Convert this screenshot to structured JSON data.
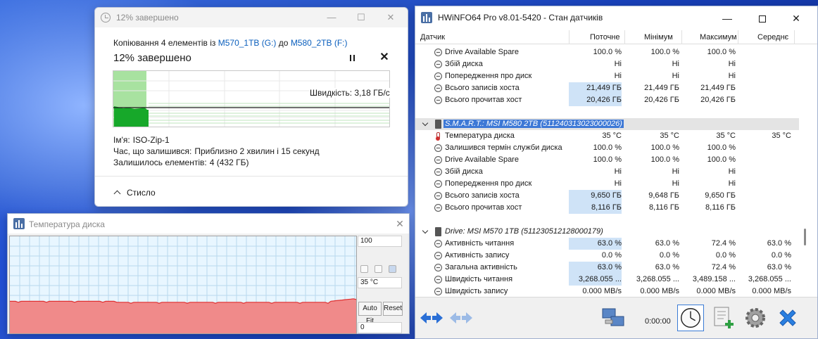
{
  "copy_dialog": {
    "title": "12% завершено",
    "desc_prefix": "Копіювання 4 елементів із",
    "source": "M570_1TB (G:)",
    "desc_mid": "до",
    "dest": "M580_2TB (F:)",
    "percent_label": "12% завершено",
    "progress_fraction": 0.12,
    "speed_label": "Швидкість: 3,18 ГБ/с",
    "name_label": "Ім'я:",
    "name_value": "ISO-Zip-1",
    "time_label": "Час, що залишився:",
    "time_value": "Приблизно 2 хвилин і 15 секунд",
    "items_label": "Залишилось елементів:",
    "items_value": "4 (432 ГБ)",
    "less_label": "Стисло",
    "close_glyph": "✕",
    "pause_icon": "pause-icon"
  },
  "temp_window": {
    "title": "Температура диска",
    "max_value": "100",
    "current_value": "35 °C",
    "min_value": "0",
    "auto_fit_label": "Auto Fit",
    "reset_label": "Reset",
    "close_glyph": "✕",
    "fill_color": "#f08a8a",
    "line_color": "#e03030"
  },
  "hwinfo": {
    "title": "HWiNFO64 Pro v8.01-5420 - Стан датчиків",
    "columns": [
      "Датчик",
      "Поточне",
      "Мінімум",
      "Максимум",
      "Середнє"
    ],
    "rows": [
      {
        "label": "Drive Available Spare",
        "cur": "100.0 %",
        "min": "100.0 %",
        "max": "100.0 %",
        "avg": ""
      },
      {
        "label": "Збій диска",
        "cur": "Ні",
        "min": "Ні",
        "max": "Ні",
        "avg": ""
      },
      {
        "label": "Попередження про диск",
        "cur": "Ні",
        "min": "Ні",
        "max": "Ні",
        "avg": ""
      },
      {
        "label": "Всього записів хоста",
        "cur": "21,449 ГБ",
        "min": "21,449 ГБ",
        "max": "21,449 ГБ",
        "avg": ""
      },
      {
        "label": "Всього прочитав хост",
        "cur": "20,426 ГБ",
        "min": "20,426 ГБ",
        "max": "20,426 ГБ",
        "avg": ""
      }
    ],
    "group2": "S.M.A.R.T.: MSI M580 2TB (511240313023000026)",
    "rows2": [
      {
        "label": "Температура диска",
        "cur": "35 °C",
        "min": "35 °C",
        "max": "35 °C",
        "avg": "35 °C"
      },
      {
        "label": "Залишився термін служби диска",
        "cur": "100.0 %",
        "min": "100.0 %",
        "max": "100.0 %",
        "avg": ""
      },
      {
        "label": "Drive Available Spare",
        "cur": "100.0 %",
        "min": "100.0 %",
        "max": "100.0 %",
        "avg": ""
      },
      {
        "label": "Збій диска",
        "cur": "Ні",
        "min": "Ні",
        "max": "Ні",
        "avg": ""
      },
      {
        "label": "Попередження про диск",
        "cur": "Ні",
        "min": "Ні",
        "max": "Ні",
        "avg": ""
      },
      {
        "label": "Всього записів хоста",
        "cur": "9,650 ГБ",
        "min": "9,648 ГБ",
        "max": "9,650 ГБ",
        "avg": ""
      },
      {
        "label": "Всього прочитав хост",
        "cur": "8,116 ГБ",
        "min": "8,116 ГБ",
        "max": "8,116 ГБ",
        "avg": ""
      }
    ],
    "group3": "Drive: MSI M570 1TB (511230512128000179)",
    "rows3": [
      {
        "label": "Активність читання",
        "cur": "63.0 %",
        "min": "63.0 %",
        "max": "72.4 %",
        "avg": "63.0 %"
      },
      {
        "label": "Активність запису",
        "cur": "0.0 %",
        "min": "0.0 %",
        "max": "0.0 %",
        "avg": "0.0 %"
      },
      {
        "label": "Загальна активність",
        "cur": "63.0 %",
        "min": "63.0 %",
        "max": "72.4 %",
        "avg": "63.0 %"
      },
      {
        "label": "Швидкість читання",
        "cur": "3,268.055 ...",
        "min": "3,268.055 ...",
        "max": "3,489.158 ...",
        "avg": "3,268.055 ..."
      },
      {
        "label": "Швидкість запису",
        "cur": "0.000 MB/s",
        "min": "0.000 MB/s",
        "max": "0.000 MB/s",
        "avg": "0.000 MB/s"
      }
    ],
    "timer": "0:00:00",
    "toolbar_icons": [
      "nav-left-right-icon",
      "nav-collapse-icon",
      "network-icon",
      "clock-icon",
      "report-add-icon",
      "settings-gear-icon",
      "close-icon"
    ]
  }
}
